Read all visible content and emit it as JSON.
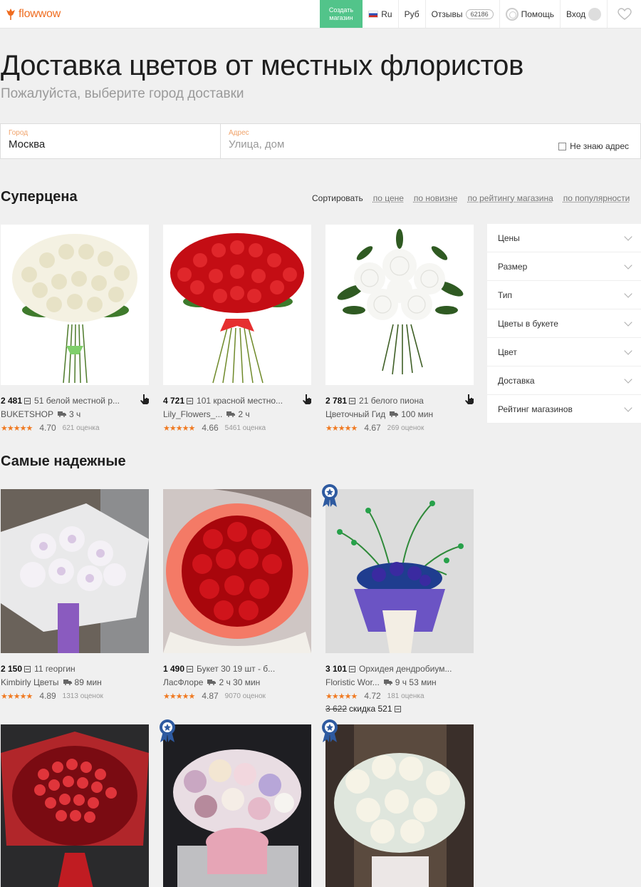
{
  "header": {
    "logo": "flowwow",
    "create_shop_line1": "Создать",
    "create_shop_line2": "магазин",
    "language": "Ru",
    "currency": "Руб",
    "reviews_label": "Отзывы",
    "reviews_count": "62186",
    "help": "Помощь",
    "login": "Вход"
  },
  "hero": {
    "title": "Доставка цветов от местных флористов",
    "subtitle": "Пожалуйста, выберите город доставки"
  },
  "address": {
    "city_label": "Город",
    "city_value": "Москва",
    "street_label": "Адрес",
    "street_placeholder": "Улица, дом",
    "unknown": "Не знаю адрес"
  },
  "supersale": {
    "title": "Суперцена",
    "sort_label": "Сортировать",
    "sort_options": [
      "по цене",
      "по новизне",
      "по рейтингу магазина",
      "по популярности"
    ],
    "items": [
      {
        "price": "2 481",
        "name": "51 белой местной р...",
        "shop": "BUKETSHOP",
        "delivery": "3 ч",
        "rating": "4.70",
        "votes": "621 оценка"
      },
      {
        "price": "4 721",
        "name": "101 красной местно...",
        "shop": "Lily_Flowers_...",
        "delivery": "2 ч",
        "rating": "4.66",
        "votes": "5461 оценка"
      },
      {
        "price": "2 781",
        "name": "21 белого пиона",
        "shop": "Цветочный Гид",
        "delivery": "100 мин",
        "rating": "4.67",
        "votes": "269 оценок"
      }
    ]
  },
  "filters": [
    "Цены",
    "Размер",
    "Тип",
    "Цветы в букете",
    "Цвет",
    "Доставка",
    "Рейтинг магазинов"
  ],
  "reliable": {
    "title": "Самые надежные",
    "items": [
      {
        "price": "2 150",
        "name": "11 георгин",
        "shop": "Kimbirly Цветы",
        "delivery": "89 мин",
        "rating": "4.89",
        "votes": "1313 оценок"
      },
      {
        "price": "1 490",
        "name": "Букет 30 19 шт - б...",
        "shop": "ЛасФлоре",
        "delivery": "2 ч 30 мин",
        "rating": "4.87",
        "votes": "9070 оценок"
      },
      {
        "price": "3 101",
        "name": "Орхидея дендробиум...",
        "shop": "Floristic Wor...",
        "delivery": "9 ч 53 мин",
        "rating": "4.72",
        "votes": "181 оценка",
        "old_price": "3 622",
        "discount": "скидка 521"
      }
    ]
  },
  "colors": {
    "accent": "#ef6c1f",
    "create_shop": "#52c48a",
    "stars": "#f07a22"
  }
}
